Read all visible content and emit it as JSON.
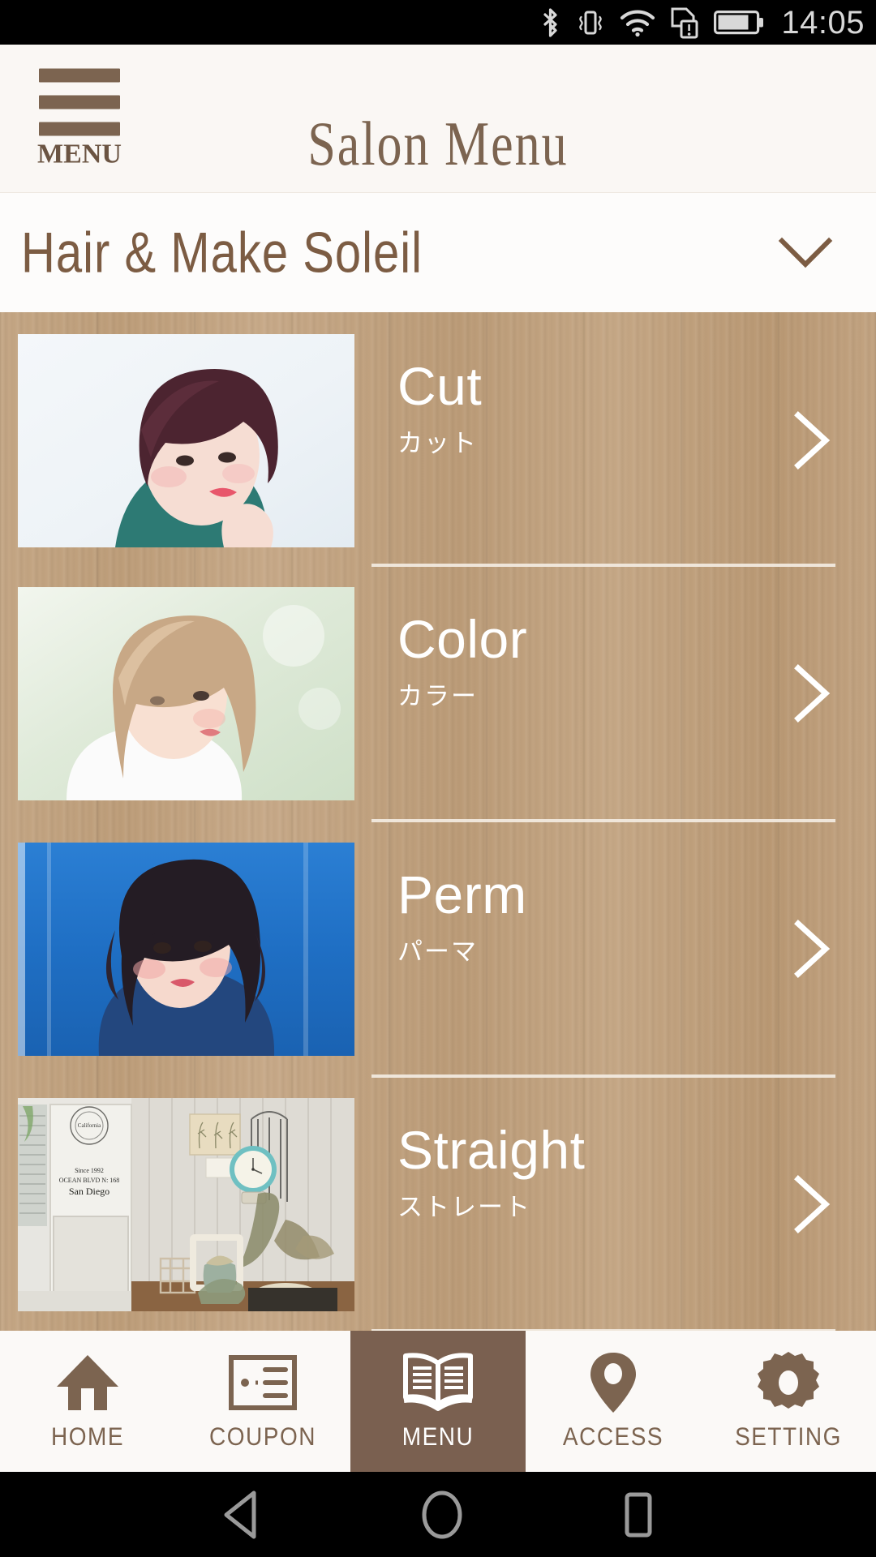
{
  "status_bar": {
    "time": "14:05",
    "icons": [
      "bluetooth-icon",
      "vibrate-icon",
      "wifi-icon",
      "sdcard-warning-icon",
      "battery-icon"
    ]
  },
  "header": {
    "menu_button_label": "MENU",
    "title": "Salon Menu",
    "hamburger_icon": "hamburger-icon"
  },
  "salon_selector": {
    "name": "Hair & Make Soleil",
    "chevron_icon": "chevron-down-icon"
  },
  "menu_items": [
    {
      "en": "Cut",
      "ja": "カット",
      "arrow_icon": "chevron-right-icon",
      "thumb": "hairstyle-short-bob-photo"
    },
    {
      "en": "Color",
      "ja": "カラー",
      "arrow_icon": "chevron-right-icon",
      "thumb": "hairstyle-beige-medium-photo"
    },
    {
      "en": "Perm",
      "ja": "パーマ",
      "arrow_icon": "chevron-right-icon",
      "thumb": "hairstyle-wavy-dark-photo"
    },
    {
      "en": "Straight",
      "ja": "ストレート",
      "arrow_icon": "chevron-right-icon",
      "thumb": "salon-interior-photo"
    }
  ],
  "bottom_nav": {
    "active_index": 2,
    "tabs": [
      {
        "label": "HOME",
        "icon": "home-icon"
      },
      {
        "label": "COUPON",
        "icon": "ticket-icon"
      },
      {
        "label": "MENU",
        "icon": "open-book-icon"
      },
      {
        "label": "ACCESS",
        "icon": "map-pin-icon"
      },
      {
        "label": "SETTING",
        "icon": "gear-icon"
      }
    ]
  },
  "android_nav": {
    "buttons": [
      {
        "name": "back-button",
        "icon": "triangle-left-icon"
      },
      {
        "name": "home-button",
        "icon": "circle-icon"
      },
      {
        "name": "recents-button",
        "icon": "square-icon"
      }
    ]
  },
  "colors": {
    "brown_accent": "#7c6450",
    "brown_active_tab": "#7a6050",
    "salon_name": "#7c5c43",
    "wood_bg": "#c0a07d",
    "header_bg": "#faf7f4",
    "divider": "#f3ece2",
    "row_text": "#ffffff",
    "status_bar_bg": "#000000",
    "status_icon": "#d8d8d8"
  }
}
